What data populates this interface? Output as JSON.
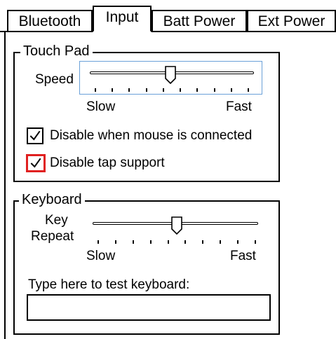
{
  "tabs": [
    {
      "label": "Bluetooth",
      "active": false
    },
    {
      "label": "Input",
      "active": true
    },
    {
      "label": "Batt Power",
      "active": false
    },
    {
      "label": "Ext Power",
      "active": false
    }
  ],
  "touchpad": {
    "title": "Touch Pad",
    "speed_label": "Speed",
    "slider_min_label": "Slow",
    "slider_max_label": "Fast",
    "speed_value_fraction": 0.49,
    "disable_mouse_label": "Disable when mouse is connected",
    "disable_mouse_checked": true,
    "disable_tap_label": "Disable tap support",
    "disable_tap_checked": true
  },
  "keyboard": {
    "title": "Keyboard",
    "key_label": "Key",
    "repeat_label": "Repeat",
    "slider_min_label": "Slow",
    "slider_max_label": "Fast",
    "repeat_value_fraction": 0.5,
    "test_label": "Type here to test keyboard:",
    "test_value": ""
  },
  "colors": {
    "focus_highlight": "#e02020",
    "slider_focus_border": "#6aa0d8"
  },
  "icons": [
    "checkmark-icon",
    "slider-thumb-icon"
  ]
}
